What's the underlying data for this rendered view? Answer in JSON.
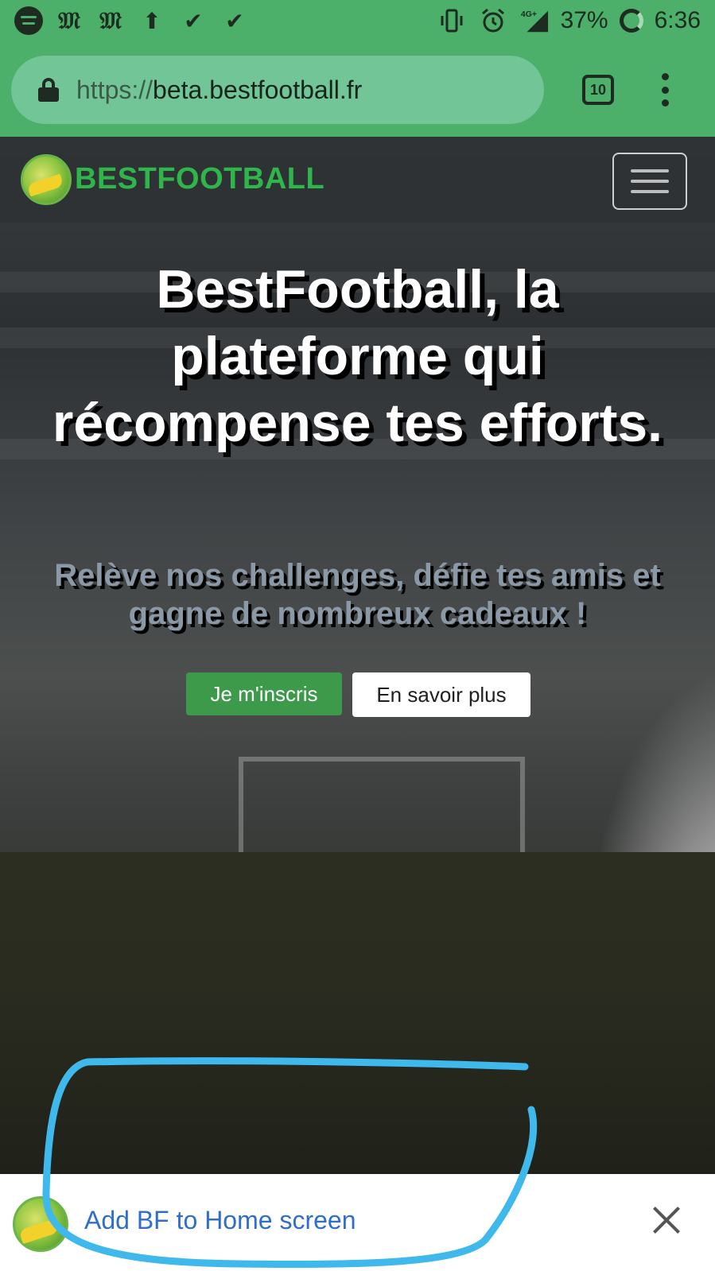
{
  "status_bar": {
    "icons_left": [
      "spotify-icon",
      "gothic-m-icon",
      "gothic-m-icon",
      "upload-icon",
      "download-done-icon",
      "download-done-icon"
    ],
    "gothic_m": "𝔐",
    "upload_glyph": "⬆",
    "check_glyph": "✔",
    "vibrate_glyph": "📳",
    "alarm_glyph": "⏰",
    "network": "4G+",
    "battery": "37%",
    "time": "6:36"
  },
  "browser": {
    "url_scheme": "https://",
    "url_host": "beta.bestfootball.fr",
    "tab_count": "10"
  },
  "site": {
    "brand": "BESTFOOTBALL",
    "headline": "BestFootball, la plateforme qui récompense tes efforts.",
    "subheadline": "Relève nos challenges, défie tes amis et gagne de nombreux cadeaux !",
    "primary_cta": "Je m'inscris",
    "secondary_cta": "En savoir plus"
  },
  "a2hs_banner": {
    "label": "Add BF to Home screen"
  },
  "colors": {
    "status_bar_bg": "#4caf6a",
    "url_pill_bg": "#72c596",
    "brand_green": "#2fb64a",
    "primary_button": "#3e9a4b",
    "banner_link": "#2f6fc9",
    "annotation_stroke": "#3fb8ec"
  }
}
